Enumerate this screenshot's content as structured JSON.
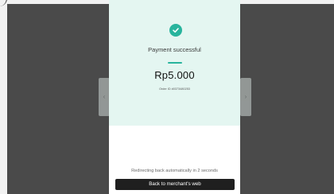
{
  "payment": {
    "status": "Payment successful",
    "amount": "Rp5.000",
    "order_id": "Order ID #0373480253"
  },
  "footer": {
    "redirect_text": "Redirecting back automatically in 2 seconds",
    "back_button_label": "Back to merchant's web"
  },
  "icons": {
    "status": "check-circle-icon"
  },
  "colors": {
    "accent": "#28b49d",
    "success_panel": "#e4f6f1",
    "button": "#1f1f1f",
    "backdrop": "#4a4a4a"
  }
}
